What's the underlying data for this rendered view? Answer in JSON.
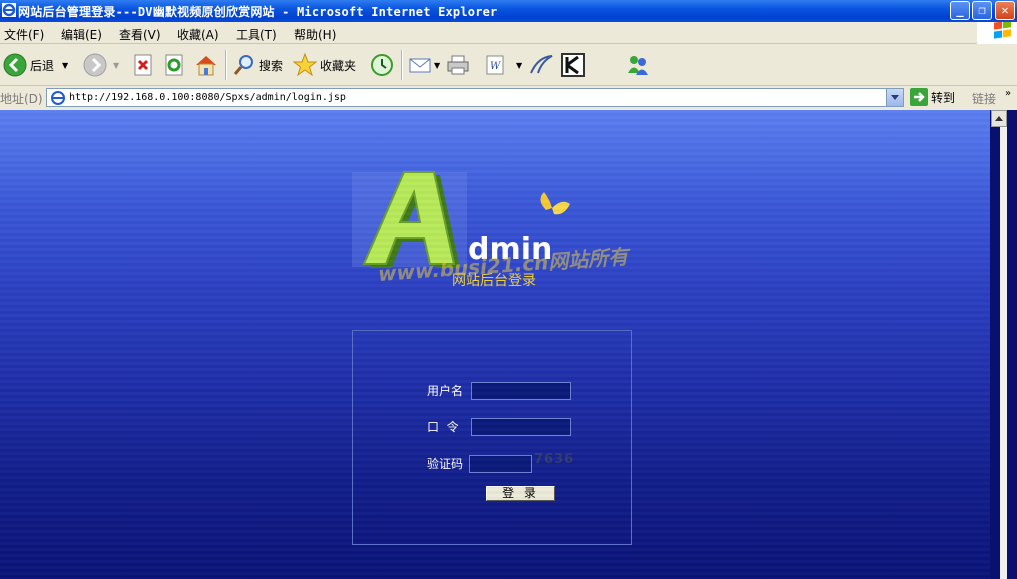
{
  "window": {
    "title": "网站后台管理登录---DV幽默视频原创欣赏网站 - Microsoft Internet Explorer",
    "minimize": "_",
    "restore": "❐",
    "close": "✕"
  },
  "menu": {
    "items": [
      {
        "label": "文件(F)"
      },
      {
        "label": "编辑(E)"
      },
      {
        "label": "查看(V)"
      },
      {
        "label": "收藏(A)"
      },
      {
        "label": "工具(T)"
      },
      {
        "label": "帮助(H)"
      }
    ]
  },
  "toolbar": {
    "back_label": "后退",
    "search_label": "搜索",
    "favorites_label": "收藏夹",
    "icons": [
      "back-icon",
      "forward-icon",
      "stop-icon",
      "refresh-icon",
      "home-icon",
      "search-icon",
      "favorites-star-icon",
      "history-icon",
      "mail-icon",
      "print-icon",
      "edit-word-icon",
      "discuss-icon",
      "kaspersky-icon",
      "messenger-icon"
    ]
  },
  "address": {
    "label": "地址(D)",
    "url": "http://192.168.0.100:8080/Spxs/admin/login.jsp",
    "go_label": "转到",
    "links_label": "链接"
  },
  "page": {
    "logo_text": "dmin",
    "logo_letter": "A",
    "subtitle": "网站后台登录",
    "watermark": "www.busi21.cn网站所有",
    "username_label": "用户名",
    "password_label": "口  令",
    "captcha_label": "验证码",
    "captcha_code": "7636",
    "login_button": "登 录",
    "username_value": "",
    "password_value": "",
    "captcha_value": ""
  },
  "colors": {
    "title_bar": "#0a55df",
    "content_top": "#5b7ff0",
    "content_bottom": "#0a1378",
    "subtitle": "#f2d234"
  }
}
